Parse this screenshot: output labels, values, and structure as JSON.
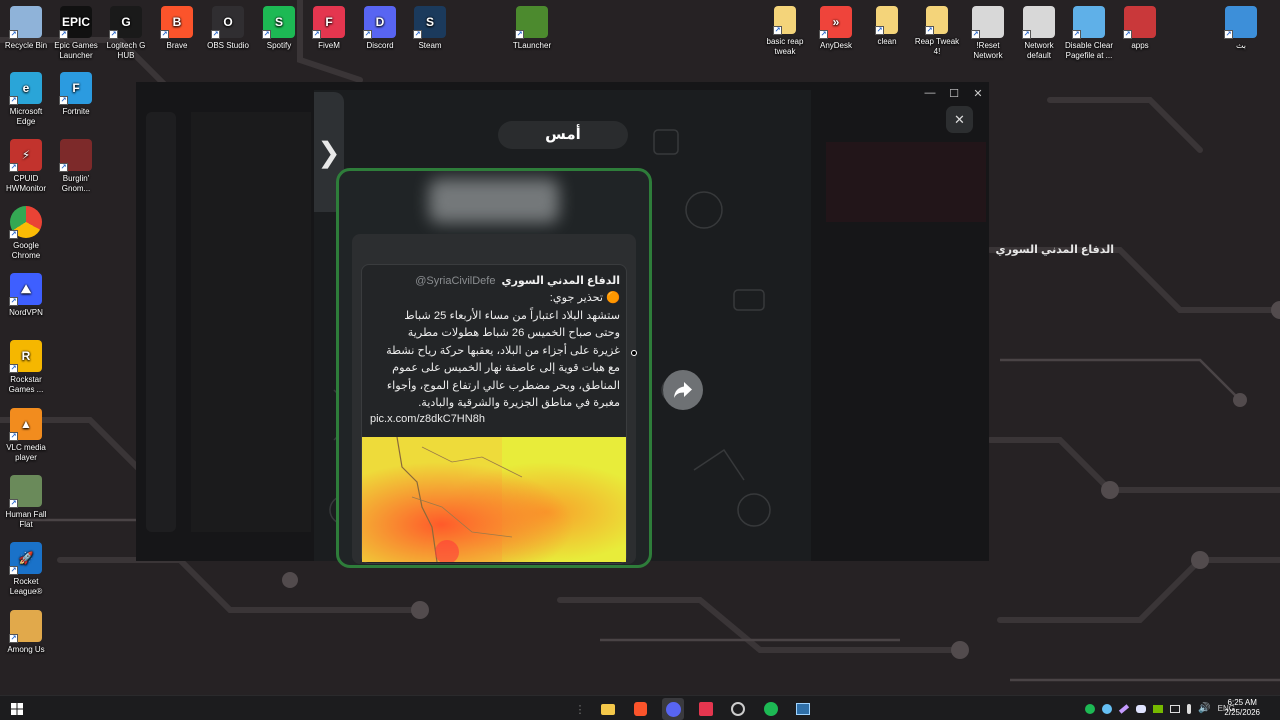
{
  "desktop": {
    "icons_top": [
      {
        "label": "Recycle Bin",
        "icon": "recycle-bin-icon",
        "color": "#8fb3d9"
      },
      {
        "label": "Epic Games Launcher",
        "icon": "epic-games-icon",
        "color": "#111111",
        "text": "EPIC"
      },
      {
        "label": "Logitech G HUB",
        "icon": "logitech-icon",
        "color": "#1a1a1a",
        "text": "G"
      },
      {
        "label": "Brave",
        "icon": "brave-icon",
        "color": "#fb542b",
        "text": "B"
      },
      {
        "label": "OBS Studio",
        "icon": "obs-icon",
        "color": "#302e31",
        "text": "O"
      },
      {
        "label": "Spotify",
        "icon": "spotify-icon",
        "color": "#1db954",
        "text": "S"
      },
      {
        "label": "FiveM",
        "icon": "fivem-icon",
        "color": "#e4364f",
        "text": "F"
      },
      {
        "label": "Discord",
        "icon": "discord-icon",
        "color": "#5865f2",
        "text": "D"
      },
      {
        "label": "Steam",
        "icon": "steam-icon",
        "color": "#1b3a5c",
        "text": "S"
      },
      {
        "label": "TLauncher",
        "icon": "tlauncher-icon",
        "color": "#4c8a2e",
        "text": ""
      }
    ],
    "icons_right": [
      {
        "label": "basic reap tweak",
        "icon": "folder-icon",
        "color": "#f4d47a"
      },
      {
        "label": "AnyDesk",
        "icon": "anydesk-icon",
        "color": "#ef443b",
        "text": "»"
      },
      {
        "label": "clean",
        "icon": "folder-icon",
        "color": "#f4d47a"
      },
      {
        "label": "Reap Tweak 4!",
        "icon": "folder-icon",
        "color": "#f4d47a"
      },
      {
        "label": "!Reset Network",
        "icon": "script-icon",
        "color": "#d8d8d8"
      },
      {
        "label": "Network default",
        "icon": "script-icon",
        "color": "#d8d8d8"
      },
      {
        "label": "Disable Clear Pagefile at ...",
        "icon": "registry-icon",
        "color": "#5fb0e8"
      },
      {
        "label": "apps",
        "icon": "archive-icon",
        "color": "#c9383a"
      },
      {
        "label": "بث",
        "icon": "window-app-icon",
        "color": "#3d8fd9"
      }
    ],
    "icons_left": [
      {
        "label": "Microsoft Edge",
        "icon": "edge-icon",
        "color": "#2aa5d8",
        "text": "e"
      },
      {
        "label": "Fortnite",
        "icon": "fortnite-icon",
        "color": "#2b9be0",
        "text": "F"
      },
      {
        "label": "CPUID HWMonitor",
        "icon": "hwmonitor-icon",
        "color": "#c2332d",
        "text": "⚡"
      },
      {
        "label": "Burglin' Gnom...",
        "icon": "burglin-gnomes-icon",
        "color": "#7d2a2a",
        "text": ""
      },
      {
        "label": "Google Chrome",
        "icon": "chrome-icon",
        "color": "#ffffff",
        "text": ""
      },
      {
        "label": "NordVPN",
        "icon": "nordvpn-icon",
        "color": "#3e5fff",
        "text": "⛰"
      },
      {
        "label": "Rockstar Games ...",
        "icon": "rockstar-icon",
        "color": "#f5b700",
        "text": "R"
      },
      {
        "label": "VLC media player",
        "icon": "vlc-icon",
        "color": "#f28c1e",
        "text": "▲"
      },
      {
        "label": "Human Fall Flat",
        "icon": "human-fall-flat-icon",
        "color": "#6a8a5a",
        "text": ""
      },
      {
        "label": "Rocket League®",
        "icon": "rocket-league-icon",
        "color": "#1a72c9",
        "text": "🚀"
      },
      {
        "label": "Among Us",
        "icon": "among-us-icon",
        "color": "#e1a94b",
        "text": ""
      }
    ]
  },
  "viewer": {
    "date_label": "أمس",
    "channel_name": "الدفاع المدني السوري",
    "quote": {
      "author_name": "الدفاع المدني السوري",
      "author_handle": "@SyriaCivilDefe",
      "lines": [
        "🟠 تحذير جوي:",
        "ستشهد البلاد اعتباراً من مساء الأربعاء 25 شباط",
        "وحتى صباح الخميس 26 شباط هطولات مطرية",
        "غزيرة على أجزاء من البلاد، يعقبها حركة رياح نشطة",
        "مع هبات قوية إلى عاصفة نهار الخميس على عموم",
        "المناطق، وبحر مضطرب عالي ارتفاع الموج، وأجواء",
        "مغبرة في مناطق الجزيرة والشرقية والبادية."
      ],
      "link": "pic.x.com/z8dkC7HN8h"
    },
    "close_label": "✕",
    "collapse_label": "❯"
  },
  "window": {
    "minimize": "—",
    "maximize": "☐",
    "close": "✕"
  },
  "taskbar": {
    "tray_lang": "ENG",
    "time": "6:25 AM",
    "date": "2/25/2026"
  }
}
